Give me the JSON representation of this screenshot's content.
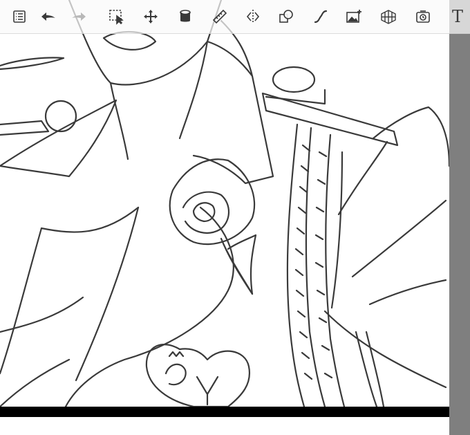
{
  "toolbar": {
    "tools": [
      {
        "icon": "layers-list-icon"
      },
      {
        "icon": "undo-icon"
      },
      {
        "icon": "redo-icon"
      },
      {
        "icon": "selection-icon"
      },
      {
        "icon": "transform-move-icon"
      },
      {
        "icon": "fill-bucket-icon"
      },
      {
        "icon": "ruler-icon"
      },
      {
        "icon": "symmetry-icon"
      },
      {
        "icon": "shape-icon"
      },
      {
        "icon": "curve-icon"
      },
      {
        "icon": "add-image-icon"
      },
      {
        "icon": "perspective-grid-icon"
      },
      {
        "icon": "timelapse-icon"
      },
      {
        "icon": "text-icon",
        "label": "T"
      }
    ]
  },
  "colors": {
    "line_art": "#3a3a3a",
    "scrollbar": "#7f7f7f",
    "canvas_bottom": "#000000",
    "toolbar_icon": "#3a3a3a",
    "toolbar_icon_disabled": "#b8b8b8"
  }
}
